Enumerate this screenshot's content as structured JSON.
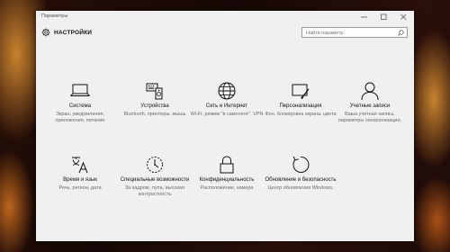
{
  "window": {
    "title": "Параметры"
  },
  "header": {
    "title": "НАСТРОЙКИ",
    "icon": "gear-icon"
  },
  "search": {
    "placeholder": "Найти параметр",
    "icon": "search-icon"
  },
  "tiles": [
    {
      "icon": "laptop-icon",
      "title": "Система",
      "desc": "Экран, уведомления, приложения, питание"
    },
    {
      "icon": "devices-icon",
      "title": "Устройства",
      "desc": "Bluetooth, принтеры, мышь"
    },
    {
      "icon": "globe-icon",
      "title": "Сеть и Интернет",
      "desc": "Wi-Fi, режим \"в самолете\", VPN"
    },
    {
      "icon": "paint-icon",
      "title": "Персонализация",
      "desc": "Фон, блокировка экрана, цвета"
    },
    {
      "icon": "person-icon",
      "title": "Учетные записи",
      "desc": "Ваша учетная запись, параметры синхронизации,"
    },
    {
      "icon": "time-language-icon",
      "title": "Время и язык",
      "desc": "Речь, регион, дата"
    },
    {
      "icon": "accessibility-timer-icon",
      "title": "Специальные возможности",
      "desc": "За кадром, лупа, высокая контрастность"
    },
    {
      "icon": "lock-icon",
      "title": "Конфиденциальность",
      "desc": "Расположение, камера"
    },
    {
      "icon": "update-icon",
      "title": "Обновление и безопасность",
      "desc": "Центр обновления Windows,"
    }
  ]
}
